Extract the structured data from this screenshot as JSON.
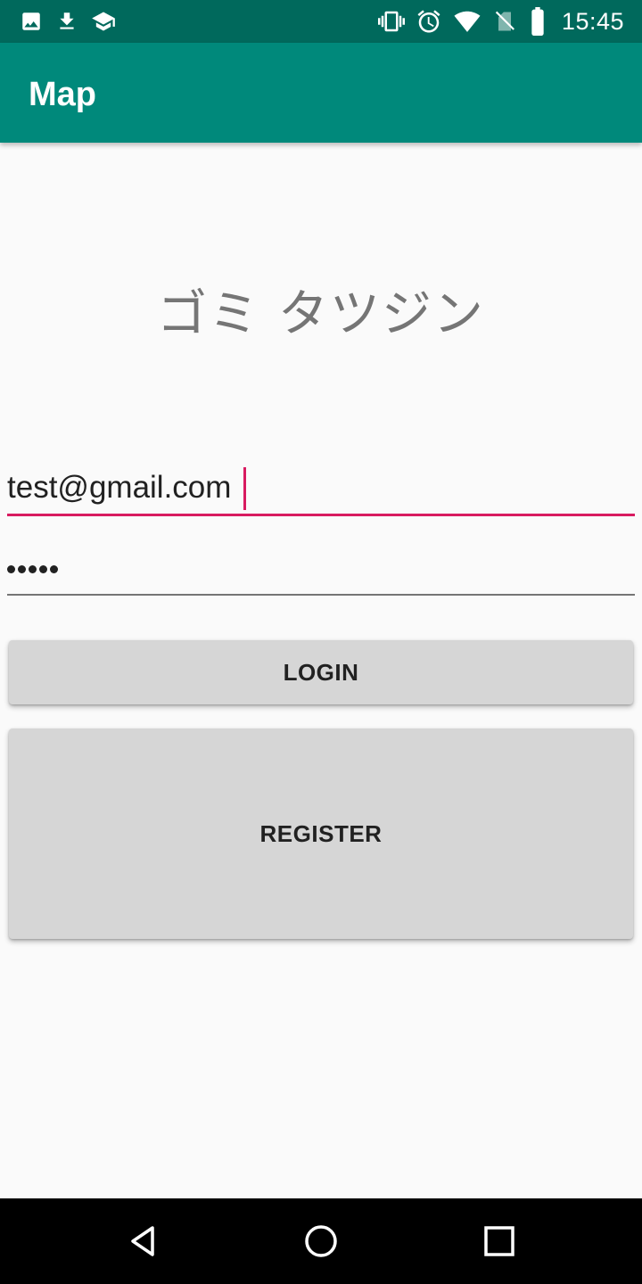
{
  "status_bar": {
    "time": "15:45",
    "left_icons": [
      "image-icon",
      "download-icon",
      "school-icon"
    ],
    "right_icons": [
      "vibrate-icon",
      "alarm-icon",
      "wifi-icon",
      "no-sim-icon",
      "battery-icon"
    ],
    "background_color": "#00695c"
  },
  "app_bar": {
    "title": "Map",
    "background_color": "#00897b"
  },
  "main": {
    "heading": "ゴミ タツジン",
    "email": {
      "value": "test@gmail.com",
      "focused": true,
      "accent_color": "#d81b60"
    },
    "password": {
      "masked_value": "•••••",
      "length": 5
    },
    "login_button": {
      "label": "LOGIN"
    },
    "register_button": {
      "label": "REGISTER"
    }
  },
  "nav_bar": {
    "buttons": [
      "back-icon",
      "home-icon",
      "recents-icon"
    ]
  }
}
